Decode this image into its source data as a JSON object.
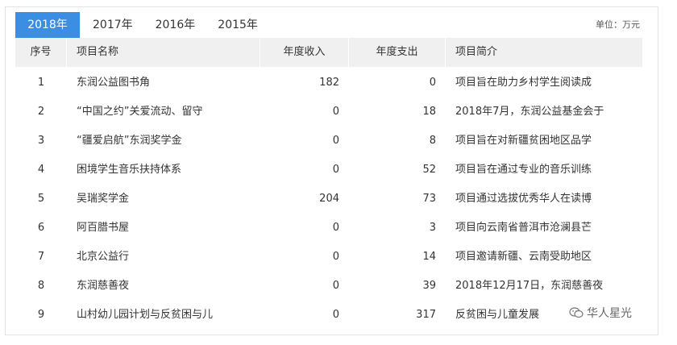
{
  "tabs": [
    {
      "label": "2018年",
      "active": true
    },
    {
      "label": "2017年",
      "active": false
    },
    {
      "label": "2016年",
      "active": false
    },
    {
      "label": "2015年",
      "active": false
    }
  ],
  "unit_label": "单位：万元",
  "columns": [
    "序号",
    "项目名称",
    "年度收入",
    "年度支出",
    "项目简介"
  ],
  "rows": [
    {
      "no": "1",
      "name": "东润公益图书角",
      "income": "182",
      "expense": "0",
      "desc": "项目旨在助力乡村学生阅读成"
    },
    {
      "no": "2",
      "name": "“中国之约”关爱流动、留守",
      "income": "0",
      "expense": "18",
      "desc": "2018年7月，东润公益基金会于"
    },
    {
      "no": "3",
      "name": "“疆爱启航”东润奖学金",
      "income": "0",
      "expense": "8",
      "desc": "项目旨在对新疆贫困地区品学"
    },
    {
      "no": "4",
      "name": "困境学生音乐扶持体系",
      "income": "0",
      "expense": "52",
      "desc": "项目旨在通过专业的音乐训练"
    },
    {
      "no": "5",
      "name": "吴瑞奖学金",
      "income": "204",
      "expense": "73",
      "desc": "项目通过选拔优秀华人在读博"
    },
    {
      "no": "6",
      "name": "阿百腊书屋",
      "income": "0",
      "expense": "3",
      "desc": "项目向云南省普洱市沧澜县芒"
    },
    {
      "no": "7",
      "name": "北京公益行",
      "income": "0",
      "expense": "14",
      "desc": "项目邀请新疆、云南受助地区"
    },
    {
      "no": "8",
      "name": "东润慈善夜",
      "income": "0",
      "expense": "39",
      "desc": "2018年12月17日，东润慈善夜"
    },
    {
      "no": "9",
      "name": "山村幼儿园计划与反贫困与儿",
      "income": "0",
      "expense": "317",
      "desc": "反贫困与儿童发展"
    }
  ],
  "watermark": "华人星光",
  "colors": {
    "accent": "#3c8ee3",
    "header_bg": "#f0f0f0"
  }
}
